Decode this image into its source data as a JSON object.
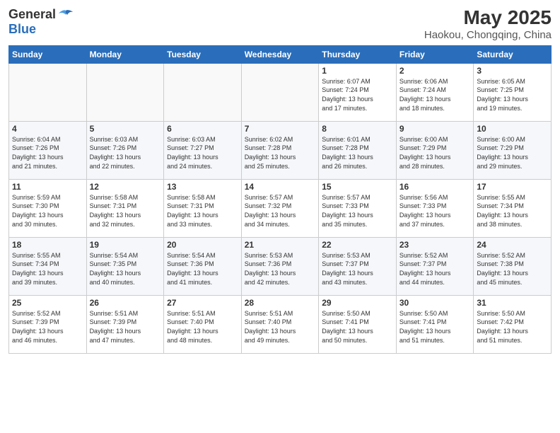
{
  "header": {
    "logo_general": "General",
    "logo_blue": "Blue",
    "title": "May 2025",
    "subtitle": "Haokou, Chongqing, China"
  },
  "days_of_week": [
    "Sunday",
    "Monday",
    "Tuesday",
    "Wednesday",
    "Thursday",
    "Friday",
    "Saturday"
  ],
  "weeks": [
    [
      {
        "day": "",
        "info": ""
      },
      {
        "day": "",
        "info": ""
      },
      {
        "day": "",
        "info": ""
      },
      {
        "day": "",
        "info": ""
      },
      {
        "day": "1",
        "info": "Sunrise: 6:07 AM\nSunset: 7:24 PM\nDaylight: 13 hours\nand 17 minutes."
      },
      {
        "day": "2",
        "info": "Sunrise: 6:06 AM\nSunset: 7:24 AM\nDaylight: 13 hours\nand 18 minutes."
      },
      {
        "day": "3",
        "info": "Sunrise: 6:05 AM\nSunset: 7:25 PM\nDaylight: 13 hours\nand 19 minutes."
      }
    ],
    [
      {
        "day": "4",
        "info": "Sunrise: 6:04 AM\nSunset: 7:26 PM\nDaylight: 13 hours\nand 21 minutes."
      },
      {
        "day": "5",
        "info": "Sunrise: 6:03 AM\nSunset: 7:26 PM\nDaylight: 13 hours\nand 22 minutes."
      },
      {
        "day": "6",
        "info": "Sunrise: 6:03 AM\nSunset: 7:27 PM\nDaylight: 13 hours\nand 24 minutes."
      },
      {
        "day": "7",
        "info": "Sunrise: 6:02 AM\nSunset: 7:28 PM\nDaylight: 13 hours\nand 25 minutes."
      },
      {
        "day": "8",
        "info": "Sunrise: 6:01 AM\nSunset: 7:28 PM\nDaylight: 13 hours\nand 26 minutes."
      },
      {
        "day": "9",
        "info": "Sunrise: 6:00 AM\nSunset: 7:29 PM\nDaylight: 13 hours\nand 28 minutes."
      },
      {
        "day": "10",
        "info": "Sunrise: 6:00 AM\nSunset: 7:29 PM\nDaylight: 13 hours\nand 29 minutes."
      }
    ],
    [
      {
        "day": "11",
        "info": "Sunrise: 5:59 AM\nSunset: 7:30 PM\nDaylight: 13 hours\nand 30 minutes."
      },
      {
        "day": "12",
        "info": "Sunrise: 5:58 AM\nSunset: 7:31 PM\nDaylight: 13 hours\nand 32 minutes."
      },
      {
        "day": "13",
        "info": "Sunrise: 5:58 AM\nSunset: 7:31 PM\nDaylight: 13 hours\nand 33 minutes."
      },
      {
        "day": "14",
        "info": "Sunrise: 5:57 AM\nSunset: 7:32 PM\nDaylight: 13 hours\nand 34 minutes."
      },
      {
        "day": "15",
        "info": "Sunrise: 5:57 AM\nSunset: 7:33 PM\nDaylight: 13 hours\nand 35 minutes."
      },
      {
        "day": "16",
        "info": "Sunrise: 5:56 AM\nSunset: 7:33 PM\nDaylight: 13 hours\nand 37 minutes."
      },
      {
        "day": "17",
        "info": "Sunrise: 5:55 AM\nSunset: 7:34 PM\nDaylight: 13 hours\nand 38 minutes."
      }
    ],
    [
      {
        "day": "18",
        "info": "Sunrise: 5:55 AM\nSunset: 7:34 PM\nDaylight: 13 hours\nand 39 minutes."
      },
      {
        "day": "19",
        "info": "Sunrise: 5:54 AM\nSunset: 7:35 PM\nDaylight: 13 hours\nand 40 minutes."
      },
      {
        "day": "20",
        "info": "Sunrise: 5:54 AM\nSunset: 7:36 PM\nDaylight: 13 hours\nand 41 minutes."
      },
      {
        "day": "21",
        "info": "Sunrise: 5:53 AM\nSunset: 7:36 PM\nDaylight: 13 hours\nand 42 minutes."
      },
      {
        "day": "22",
        "info": "Sunrise: 5:53 AM\nSunset: 7:37 PM\nDaylight: 13 hours\nand 43 minutes."
      },
      {
        "day": "23",
        "info": "Sunrise: 5:52 AM\nSunset: 7:37 PM\nDaylight: 13 hours\nand 44 minutes."
      },
      {
        "day": "24",
        "info": "Sunrise: 5:52 AM\nSunset: 7:38 PM\nDaylight: 13 hours\nand 45 minutes."
      }
    ],
    [
      {
        "day": "25",
        "info": "Sunrise: 5:52 AM\nSunset: 7:39 PM\nDaylight: 13 hours\nand 46 minutes."
      },
      {
        "day": "26",
        "info": "Sunrise: 5:51 AM\nSunset: 7:39 PM\nDaylight: 13 hours\nand 47 minutes."
      },
      {
        "day": "27",
        "info": "Sunrise: 5:51 AM\nSunset: 7:40 PM\nDaylight: 13 hours\nand 48 minutes."
      },
      {
        "day": "28",
        "info": "Sunrise: 5:51 AM\nSunset: 7:40 PM\nDaylight: 13 hours\nand 49 minutes."
      },
      {
        "day": "29",
        "info": "Sunrise: 5:50 AM\nSunset: 7:41 PM\nDaylight: 13 hours\nand 50 minutes."
      },
      {
        "day": "30",
        "info": "Sunrise: 5:50 AM\nSunset: 7:41 PM\nDaylight: 13 hours\nand 51 minutes."
      },
      {
        "day": "31",
        "info": "Sunrise: 5:50 AM\nSunset: 7:42 PM\nDaylight: 13 hours\nand 51 minutes."
      }
    ]
  ]
}
